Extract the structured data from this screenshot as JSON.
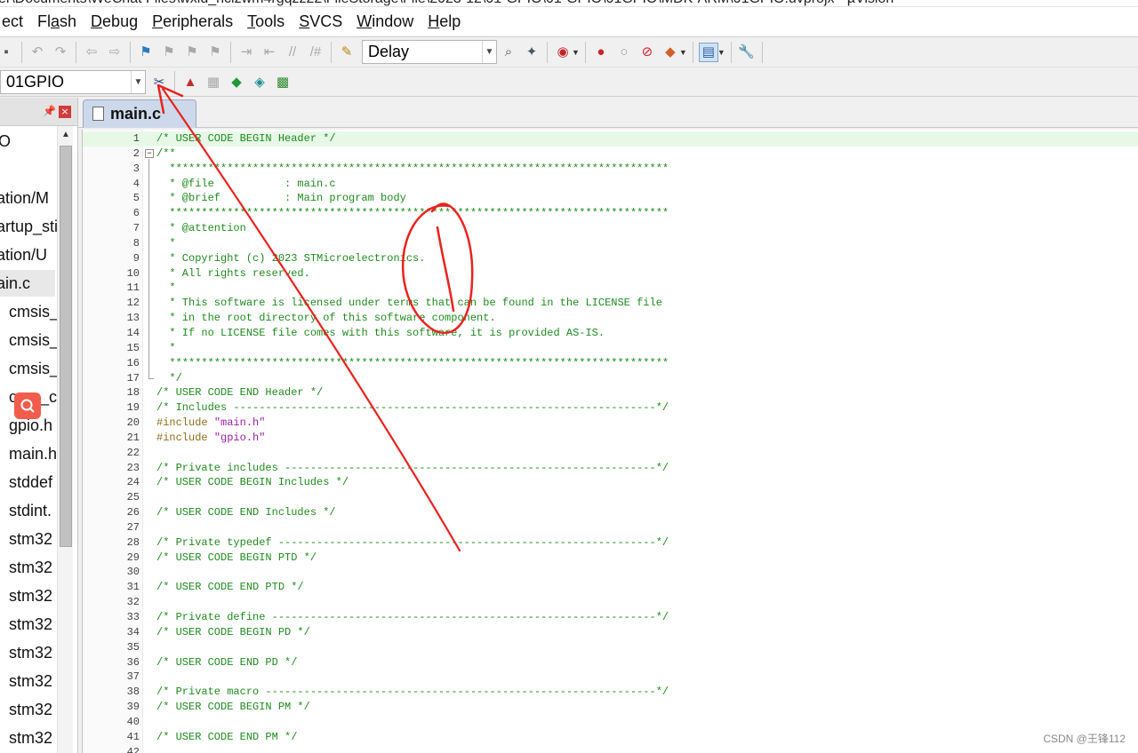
{
  "window": {
    "title_partial": "er\\Documents\\WeChat Files\\wxid_ncizwm4rgqzz22\\FileStorage\\File\\2023-12\\01-GPIO\\01-GPIO\\01GPIO\\MDK-ARM\\01GPIO.uvprojx - µVision"
  },
  "menu": [
    {
      "label": "ect",
      "mnemonic": ""
    },
    {
      "label": "Flash",
      "mnemonic": "a"
    },
    {
      "label": "Debug",
      "mnemonic": "D"
    },
    {
      "label": "Peripherals",
      "mnemonic": "P"
    },
    {
      "label": "Tools",
      "mnemonic": "T"
    },
    {
      "label": "SVCS",
      "mnemonic": "S"
    },
    {
      "label": "Window",
      "mnemonic": "W"
    },
    {
      "label": "Help",
      "mnemonic": "H"
    }
  ],
  "toolbar": {
    "find_combo_value": "Delay",
    "target_combo_value": "01GPIO"
  },
  "project_panel": {
    "items": [
      {
        "label": "O"
      },
      {
        "label": ""
      },
      {
        "label": "ation/M"
      },
      {
        "label": "artup_sti"
      },
      {
        "label": "ation/U"
      },
      {
        "label": "ain.c"
      },
      {
        "label": "cmsis_"
      },
      {
        "label": "cmsis_"
      },
      {
        "label": "cmsis_"
      },
      {
        "label": "core_c"
      },
      {
        "label": "gpio.h"
      },
      {
        "label": "main.h"
      },
      {
        "label": "stddef"
      },
      {
        "label": "stdint."
      },
      {
        "label": "stm32"
      },
      {
        "label": "stm32"
      },
      {
        "label": "stm32"
      },
      {
        "label": "stm32"
      },
      {
        "label": "stm32"
      },
      {
        "label": "stm32"
      },
      {
        "label": "stm32"
      },
      {
        "label": "stm32"
      }
    ]
  },
  "editor": {
    "tab_label": "main.c",
    "lines": [
      {
        "n": "1",
        "t": "/* USER CODE BEGIN Header */",
        "k": "comment"
      },
      {
        "n": "2",
        "t": "/**",
        "k": "comment"
      },
      {
        "n": "3",
        "t": "  ******************************************************************************",
        "k": "comment"
      },
      {
        "n": "4",
        "t": "  * @file           : main.c",
        "k": "comment"
      },
      {
        "n": "5",
        "t": "  * @brief          : Main program body",
        "k": "comment"
      },
      {
        "n": "6",
        "t": "  ******************************************************************************",
        "k": "comment"
      },
      {
        "n": "7",
        "t": "  * @attention",
        "k": "comment"
      },
      {
        "n": "8",
        "t": "  *",
        "k": "comment"
      },
      {
        "n": "9",
        "t": "  * Copyright (c) 2023 STMicroelectronics.",
        "k": "comment"
      },
      {
        "n": "10",
        "t": "  * All rights reserved.",
        "k": "comment"
      },
      {
        "n": "11",
        "t": "  *",
        "k": "comment"
      },
      {
        "n": "12",
        "t": "  * This software is licensed under terms that can be found in the LICENSE file",
        "k": "comment"
      },
      {
        "n": "13",
        "t": "  * in the root directory of this software component.",
        "k": "comment"
      },
      {
        "n": "14",
        "t": "  * If no LICENSE file comes with this software, it is provided AS-IS.",
        "k": "comment"
      },
      {
        "n": "15",
        "t": "  *",
        "k": "comment"
      },
      {
        "n": "16",
        "t": "  ******************************************************************************",
        "k": "comment"
      },
      {
        "n": "17",
        "t": "  */",
        "k": "comment"
      },
      {
        "n": "18",
        "t": "/* USER CODE END Header */",
        "k": "comment"
      },
      {
        "n": "19",
        "t": "/* Includes ------------------------------------------------------------------*/",
        "k": "comment"
      },
      {
        "n": "20",
        "t": "#include \"main.h\"",
        "k": "include",
        "pre": "#include ",
        "str": "\"main.h\""
      },
      {
        "n": "21",
        "t": "#include \"gpio.h\"",
        "k": "include",
        "pre": "#include ",
        "str": "\"gpio.h\""
      },
      {
        "n": "22",
        "t": "",
        "k": "plain"
      },
      {
        "n": "23",
        "t": "/* Private includes ----------------------------------------------------------*/",
        "k": "comment"
      },
      {
        "n": "24",
        "t": "/* USER CODE BEGIN Includes */",
        "k": "comment"
      },
      {
        "n": "25",
        "t": "",
        "k": "plain"
      },
      {
        "n": "26",
        "t": "/* USER CODE END Includes */",
        "k": "comment"
      },
      {
        "n": "27",
        "t": "",
        "k": "plain"
      },
      {
        "n": "28",
        "t": "/* Private typedef -----------------------------------------------------------*/",
        "k": "comment"
      },
      {
        "n": "29",
        "t": "/* USER CODE BEGIN PTD */",
        "k": "comment"
      },
      {
        "n": "30",
        "t": "",
        "k": "plain"
      },
      {
        "n": "31",
        "t": "/* USER CODE END PTD */",
        "k": "comment"
      },
      {
        "n": "32",
        "t": "",
        "k": "plain"
      },
      {
        "n": "33",
        "t": "/* Private define ------------------------------------------------------------*/",
        "k": "comment"
      },
      {
        "n": "34",
        "t": "/* USER CODE BEGIN PD */",
        "k": "comment"
      },
      {
        "n": "35",
        "t": "",
        "k": "plain"
      },
      {
        "n": "36",
        "t": "/* USER CODE END PD */",
        "k": "comment"
      },
      {
        "n": "37",
        "t": "",
        "k": "plain"
      },
      {
        "n": "38",
        "t": "/* Private macro -------------------------------------------------------------*/",
        "k": "comment"
      },
      {
        "n": "39",
        "t": "/* USER CODE BEGIN PM */",
        "k": "comment"
      },
      {
        "n": "40",
        "t": "",
        "k": "plain"
      },
      {
        "n": "41",
        "t": "/* USER CODE END PM */",
        "k": "comment"
      },
      {
        "n": "42",
        "t": "",
        "k": "plain"
      }
    ]
  },
  "watermark": "CSDN @王锋112",
  "colors": {
    "comment": "#1f8a1f",
    "preprocessor": "#8a6d17",
    "string": "#9b1fa0",
    "current_line": "#e7f8e7",
    "annotation": "#e8231f"
  }
}
